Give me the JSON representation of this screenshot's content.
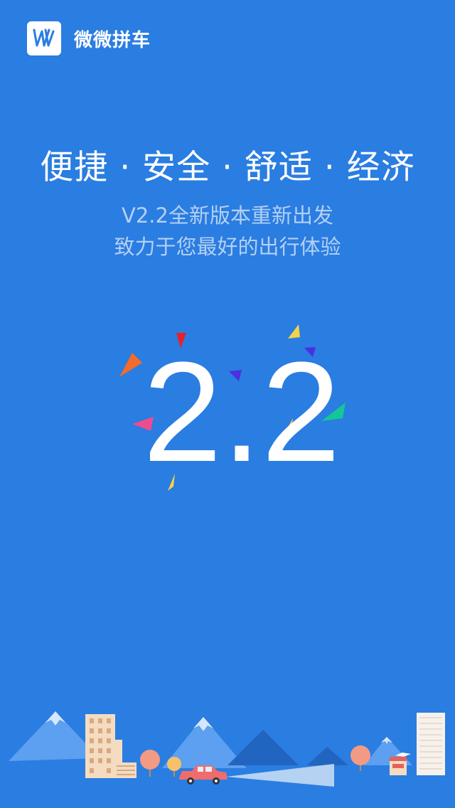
{
  "header": {
    "app_name": "微微拼车",
    "logo_icon": "vv-logo-icon"
  },
  "tagline": "便捷 · 安全 · 舒适 · 经济",
  "subtitle": {
    "line1": "V2.2全新版本重新出发",
    "line2": "致力于您最好的出行体验"
  },
  "version_display": "2.2",
  "colors": {
    "background": "#2a7de1",
    "accent_text": "#b3d0f4",
    "white": "#ffffff"
  }
}
